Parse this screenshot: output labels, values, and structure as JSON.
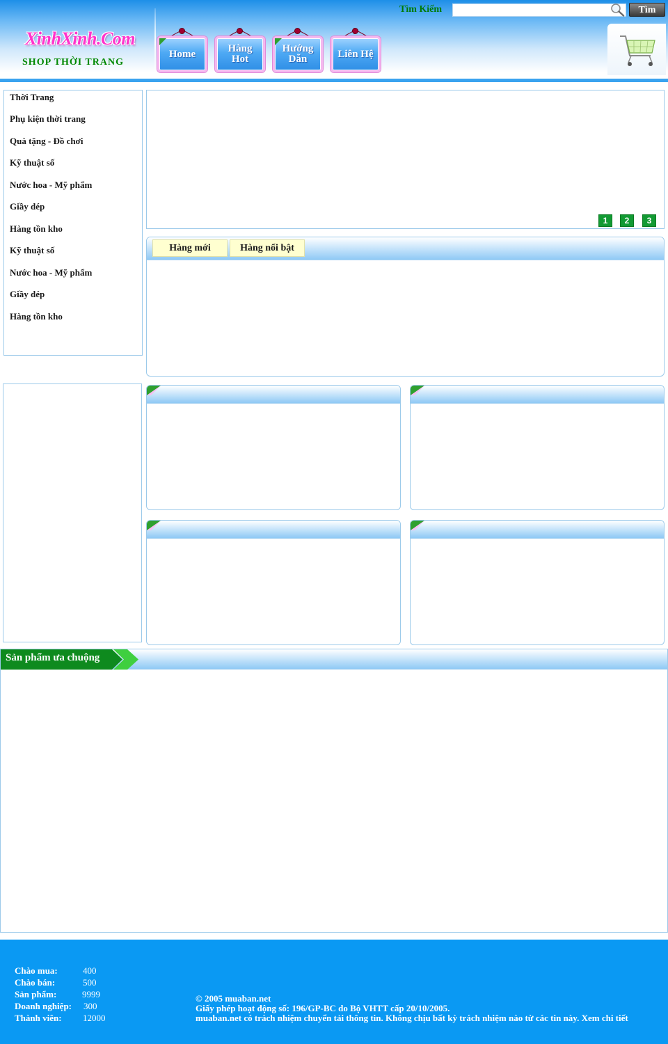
{
  "header": {
    "logo_text": "XinhXinh.Com",
    "logo_subtitle": "SHOP THỜI TRANG",
    "nav": [
      {
        "label": "Home"
      },
      {
        "label": "Hàng Hot"
      },
      {
        "label": "Hướng Dẫn"
      },
      {
        "label": "Liên Hệ"
      }
    ],
    "search_label": "Tìm Kiếm",
    "search_value": "",
    "search_button": "Tìm"
  },
  "sidebar": {
    "categories": [
      "Thời Trang",
      "Phụ kiện thời trang",
      "Quà tặng - Đồ chơi",
      "Kỹ thuật số",
      "Nước hoa - Mỹ phẩm",
      "Giầy dép",
      "Hàng tồn kho",
      "Kỹ thuật số",
      "Nước hoa - Mỹ phẩm",
      "Giầy dép",
      "Hàng tồn kho"
    ]
  },
  "banner": {
    "slides": [
      "1",
      "2",
      "3"
    ]
  },
  "tabs": {
    "items": [
      "Hàng mới",
      "Hàng nổi bật"
    ]
  },
  "popular": {
    "title": "Sản phẩm ưa chuộng"
  },
  "footer": {
    "stats": [
      {
        "label": "Chào mua:",
        "value": "400"
      },
      {
        "label": "Chào bán:",
        "value": "500"
      },
      {
        "label": "Sản phẩm:",
        "value": "9999"
      },
      {
        "label": "Doanh nghiệp:",
        "value": "300"
      },
      {
        "label": "Thành viên:",
        "value": "12000"
      }
    ],
    "copyright": "© 2005 muaban.net",
    "license": "Giấy phép hoạt động số: 196/GP-BC do Bộ VHTT cấp 20/10/2005.",
    "disclaimer": "muaban.net có trách nhiệm chuyển tải thông tin. Không chịu bất kỳ trách nhiệm nào từ các tin này. Xem chi tiết"
  },
  "colors": {
    "header_blue": "#1e8fe8",
    "footer_blue": "#0a99f3",
    "accent_green": "#129a33",
    "logo_pink": "#ff33cc",
    "tab_yellow": "#ffffd0"
  }
}
